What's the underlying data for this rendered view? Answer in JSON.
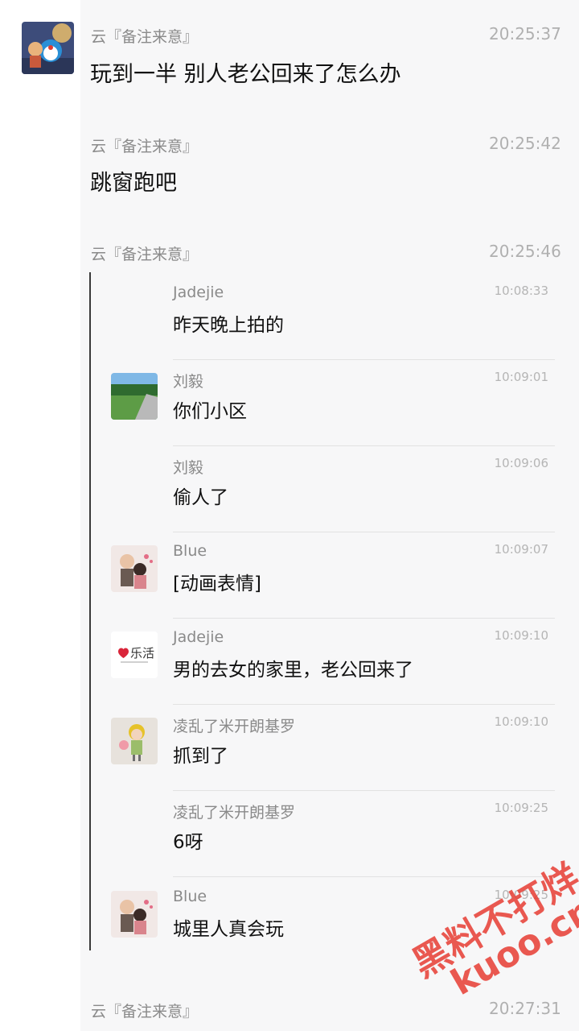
{
  "messages": [
    {
      "sender": "云『备注来意』",
      "time": "20:25:37",
      "text": "玩到一半 别人老公回来了怎么办"
    },
    {
      "sender": "云『备注来意』",
      "time": "20:25:42",
      "text": "跳窗跑吧"
    },
    {
      "sender": "云『备注来意』",
      "time": "20:25:46"
    },
    {
      "sender": "云『备注来意』",
      "time": "20:27:31"
    }
  ],
  "forwarded": [
    {
      "sender": "Jadejie",
      "time": "10:08:33",
      "text": "昨天晚上拍的",
      "avatar": "none"
    },
    {
      "sender": "刘毅",
      "time": "10:09:01",
      "text": "你们小区",
      "avatar": "road-photo"
    },
    {
      "sender": "刘毅",
      "time": "10:09:06",
      "text": "偷人了",
      "avatar": "none"
    },
    {
      "sender": "Blue",
      "time": "10:09:07",
      "text": "[动画表情]",
      "avatar": "couple-illustration"
    },
    {
      "sender": "Jadejie",
      "time": "10:09:10",
      "text": "男的去女的家里，老公回来了",
      "avatar": "lehuo-logo",
      "avatar_text": "乐活"
    },
    {
      "sender": "凌乱了米开朗基罗",
      "time": "10:09:10",
      "text": "抓到了",
      "avatar": "girl-illustration"
    },
    {
      "sender": "凌乱了米开朗基罗",
      "time": "10:09:25",
      "text": "6呀",
      "avatar": "none"
    },
    {
      "sender": "Blue",
      "time": "10:09:25",
      "text": "城里人真会玩",
      "avatar": "couple-illustration"
    }
  ],
  "watermark": {
    "line1": "黑料不打烊",
    "line2": "kuoo.cn"
  },
  "colors": {
    "panel_bg": "#f7f7f8",
    "watermark": "#e63c32",
    "quote_bar": "#3a3a3a"
  }
}
